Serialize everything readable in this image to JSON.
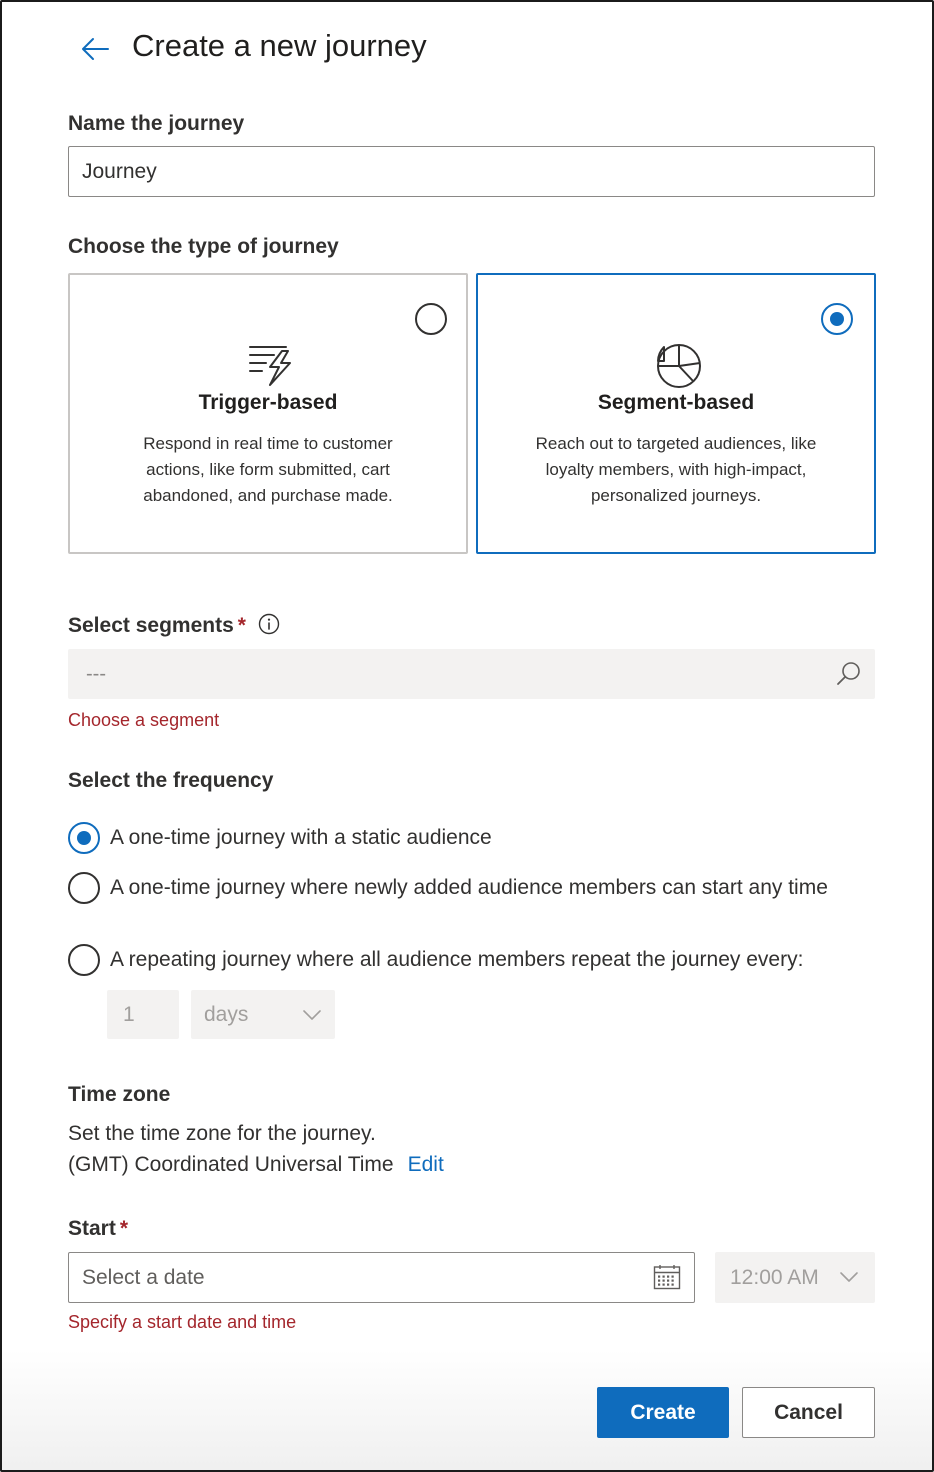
{
  "header": {
    "title": "Create a new journey",
    "back_icon": "arrow-left-icon"
  },
  "name_section": {
    "label": "Name the journey",
    "value": "Journey"
  },
  "type_section": {
    "label": "Choose the type of journey",
    "cards": [
      {
        "id": "trigger",
        "icon": "lightning-lines-icon",
        "title": "Trigger-based",
        "description": "Respond in real time to customer actions, like form submitted, cart abandoned, and purchase made.",
        "selected": false
      },
      {
        "id": "segment",
        "icon": "pie-chart-icon",
        "title": "Segment-based",
        "description": "Reach out to targeted audiences, like loyalty members, with high-impact, personalized journeys.",
        "selected": true
      }
    ]
  },
  "segments": {
    "label": "Select segments",
    "required_marker": "*",
    "info_icon": "info-icon",
    "placeholder": "---",
    "search_icon": "search-icon",
    "error": "Choose a segment"
  },
  "frequency": {
    "label": "Select the frequency",
    "options": [
      {
        "text": "A one-time journey with a static audience",
        "checked": true
      },
      {
        "text": "A one-time journey where newly added audience members can start any time",
        "checked": false
      },
      {
        "text": "A repeating journey where all audience members repeat the journey every:",
        "checked": false
      }
    ],
    "repeat_count": "1",
    "repeat_unit": "days"
  },
  "timezone": {
    "label": "Time zone",
    "description": "Set the time zone for the journey.",
    "value": "(GMT) Coordinated Universal Time",
    "edit_label": "Edit"
  },
  "start": {
    "label": "Start",
    "required_marker": "*",
    "date_placeholder": "Select a date",
    "calendar_icon": "calendar-icon",
    "time_value": "12:00 AM",
    "error": "Specify a start date and time"
  },
  "footer": {
    "create_label": "Create",
    "cancel_label": "Cancel"
  },
  "colors": {
    "accent": "#0f6cbd",
    "error": "#a4262c",
    "text": "#323130",
    "disabled_bg": "#f3f2f1"
  }
}
